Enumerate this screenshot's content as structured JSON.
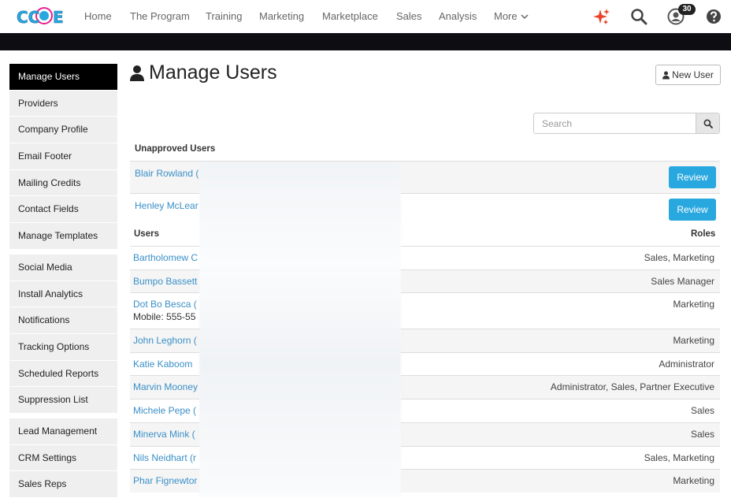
{
  "logo": {
    "text": "CCOE"
  },
  "nav": {
    "items": [
      "Home",
      "The Program",
      "Training",
      "Marketing",
      "Marketplace",
      "Sales",
      "Analysis",
      "More"
    ],
    "notification_count": "30"
  },
  "sidebar": {
    "groups": [
      [
        "Manage Users",
        "Providers",
        "Company Profile",
        "Email Footer",
        "Mailing Credits",
        "Contact Fields",
        "Manage Templates"
      ],
      [
        "Social Media",
        "Install Analytics",
        "Notifications",
        "Tracking Options",
        "Scheduled Reports",
        "Suppression List"
      ],
      [
        "Lead Management",
        "CRM Settings",
        "Sales Reps"
      ]
    ]
  },
  "page": {
    "title": "Manage Users",
    "new_user_label": "New User",
    "search_placeholder": "Search"
  },
  "unapproved": {
    "heading": "Unapproved Users",
    "review_label": "Review",
    "rows": [
      "Blair Rowland (",
      "Henley McLear"
    ]
  },
  "users": {
    "heading": "Users",
    "roles_heading": "Roles",
    "rows": [
      {
        "name": "Bartholomew C",
        "role": "Sales, Marketing"
      },
      {
        "name": "Bumpo Bassett",
        "role": "Sales Manager"
      },
      {
        "name": "Dot Bo Besca (",
        "sub": "Mobile: 555-55",
        "role": "Marketing"
      },
      {
        "name": "John Leghorn (",
        "role": "Marketing"
      },
      {
        "name": "Katie Kaboom",
        "role": "Administrator"
      },
      {
        "name": "Marvin Mooney",
        "role": "Administrator, Sales, Partner Executive"
      },
      {
        "name": "Michele Pepe (",
        "role": "Sales"
      },
      {
        "name": "Minerva Mink (",
        "role": "Sales"
      },
      {
        "name": "Nils Neidhart (r",
        "role": "Sales, Marketing"
      },
      {
        "name": "Phar Fignewtor",
        "role": "Marketing"
      }
    ]
  },
  "colors": {
    "accent": "#29a8df",
    "link": "#3a8fc7",
    "sidebar_active": "#000000",
    "spark": "#e8432b"
  }
}
